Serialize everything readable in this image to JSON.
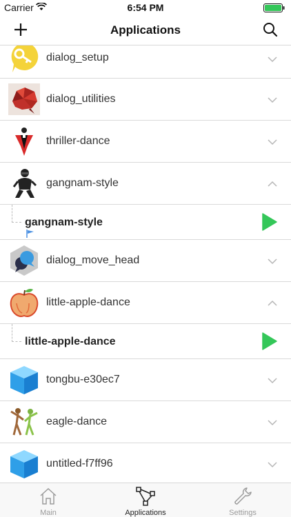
{
  "status": {
    "carrier": "Carrier",
    "time": "6:54 PM"
  },
  "nav": {
    "title": "Applications"
  },
  "apps": [
    {
      "name": "dialog_setup",
      "expanded": false
    },
    {
      "name": "dialog_utilities",
      "expanded": false
    },
    {
      "name": "thriller-dance",
      "expanded": false
    },
    {
      "name": "gangnam-style",
      "expanded": true,
      "child": "gangnam-style"
    },
    {
      "name": "dialog_move_head",
      "expanded": false
    },
    {
      "name": "little-apple-dance",
      "expanded": true,
      "child": "little-apple-dance"
    },
    {
      "name": "tongbu-e30ec7",
      "expanded": false
    },
    {
      "name": "eagle-dance",
      "expanded": false
    },
    {
      "name": "untitled-f7ff96",
      "expanded": false
    }
  ],
  "tabs": [
    {
      "label": "Main",
      "active": false
    },
    {
      "label": "Applications",
      "active": true
    },
    {
      "label": "Settings",
      "active": false
    }
  ],
  "colors": {
    "play": "#34c759",
    "separator": "#d9d9d9",
    "flag": "#4a90e2"
  }
}
